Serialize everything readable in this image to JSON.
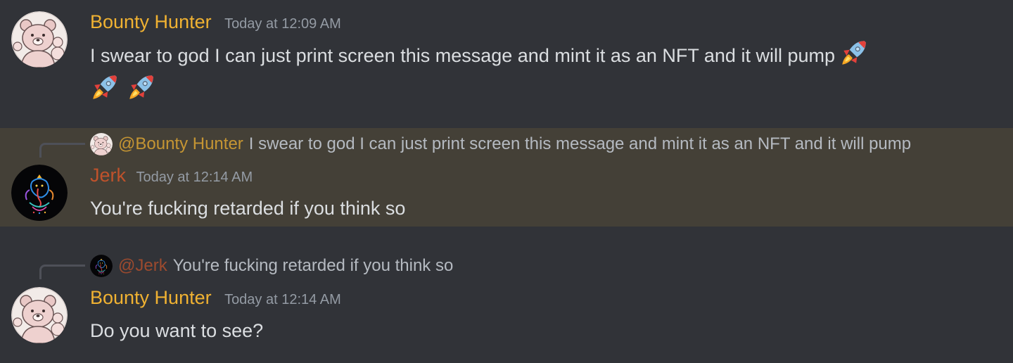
{
  "colors": {
    "background": "#313338",
    "highlight": "#444037",
    "bounty_hunter": "#f0b232",
    "jerk": "#c0522b"
  },
  "messages": [
    {
      "username": "Bounty Hunter",
      "timestamp": "Today at 12:09 AM",
      "text": "I swear to god I can just print screen this message and mint it as an NFT and it will pump",
      "emoji": [
        "rocket",
        "rocket",
        "rocket"
      ]
    },
    {
      "reply_to": {
        "mention": "@Bounty Hunter",
        "text": "I swear to god I can just print screen this message and mint it as an NFT and it will pump"
      },
      "username": "Jerk",
      "timestamp": "Today at 12:14 AM",
      "text": "You're fucking retarded if you think so",
      "highlighted": true
    },
    {
      "reply_to": {
        "mention": "@Jerk",
        "text": "You're fucking retarded if you think so"
      },
      "username": "Bounty Hunter",
      "timestamp": "Today at 12:14 AM",
      "text": "Do you want to see?"
    }
  ]
}
